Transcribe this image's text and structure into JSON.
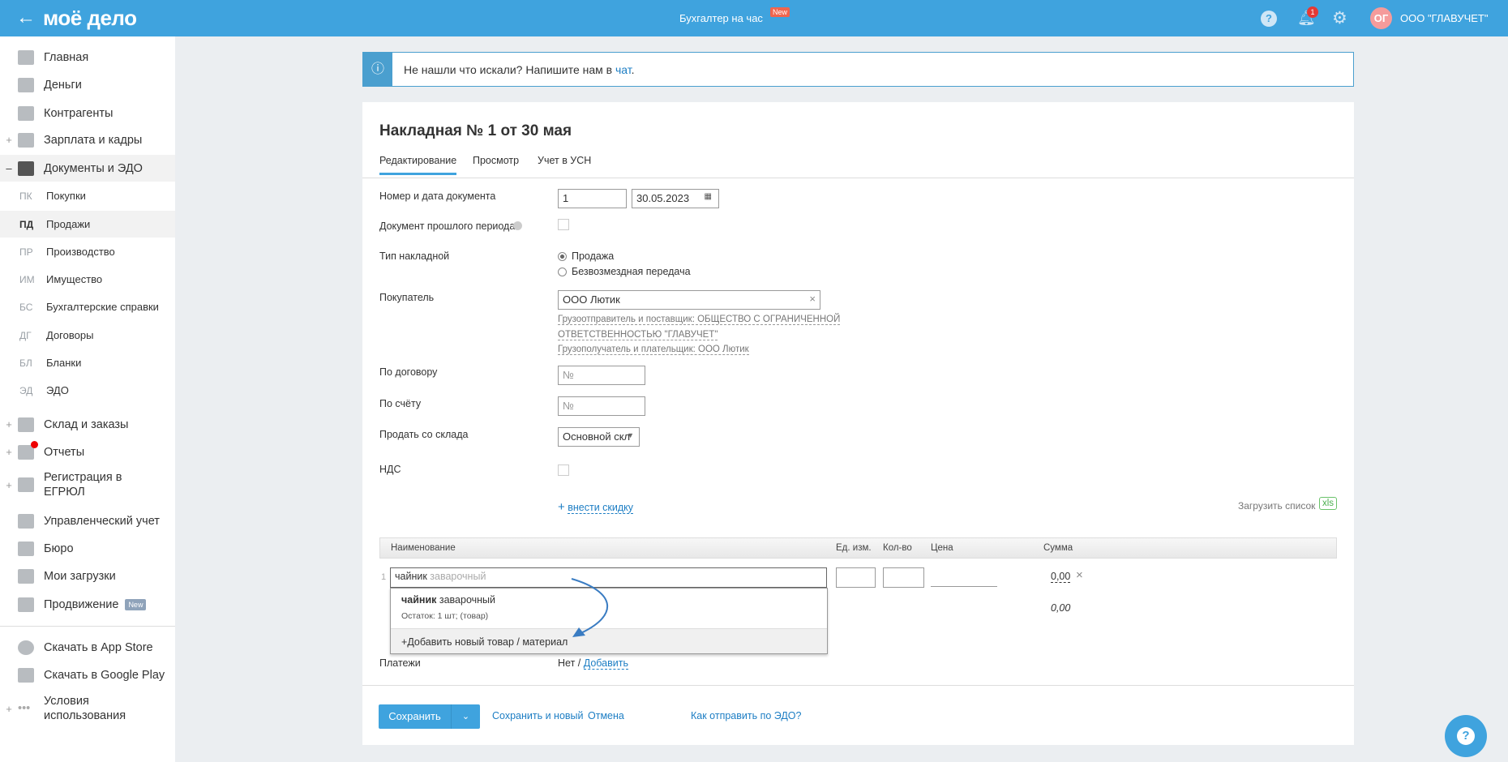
{
  "header": {
    "logo": "моё дело",
    "center_link": "Бухгалтер на час",
    "new_badge": "New",
    "notifications_count": "1",
    "avatar_initials": "ОГ",
    "company": "ООО \"ГЛАВУЧЕТ\""
  },
  "sidebar": {
    "items": [
      {
        "label": "Главная"
      },
      {
        "label": "Деньги"
      },
      {
        "label": "Контрагенты"
      },
      {
        "label": "Зарплата и кадры"
      },
      {
        "label": "Документы и ЭДО"
      }
    ],
    "sub": [
      {
        "abbr": "ПК",
        "label": "Покупки"
      },
      {
        "abbr": "ПД",
        "label": "Продажи"
      },
      {
        "abbr": "ПР",
        "label": "Производство"
      },
      {
        "abbr": "ИМ",
        "label": "Имущество"
      },
      {
        "abbr": "БС",
        "label": "Бухгалтерские справки"
      },
      {
        "abbr": "ДГ",
        "label": "Договоры"
      },
      {
        "abbr": "БЛ",
        "label": "Бланки"
      },
      {
        "abbr": "ЭД",
        "label": "ЭДО"
      }
    ],
    "items2": [
      {
        "label": "Склад и заказы"
      },
      {
        "label": "Отчеты"
      },
      {
        "label": "Регистрация в ЕГРЮЛ"
      },
      {
        "label": "Управленческий учет"
      },
      {
        "label": "Бюро"
      },
      {
        "label": "Мои загрузки"
      },
      {
        "label": "Продвижение"
      }
    ],
    "promo_badge": "New",
    "bottom": [
      {
        "label": "Скачать в App Store"
      },
      {
        "label": "Скачать в Google Play"
      },
      {
        "label": "Условия использования"
      }
    ]
  },
  "info": {
    "text": "Не нашли что искали? Напишите нам в ",
    "link": "чат",
    "dot": "."
  },
  "doc": {
    "title": "Накладная № 1 от 30 мая",
    "tabs": [
      "Редактирование",
      "Просмотр",
      "Учет в УСН"
    ],
    "labels": {
      "number_date": "Номер и дата документа",
      "past_period": "Документ прошлого периода",
      "type": "Тип накладной",
      "buyer": "Покупатель",
      "contract": "По договору",
      "invoice": "По счёту",
      "warehouse": "Продать со склада",
      "vat": "НДС",
      "payments": "Платежи"
    },
    "number": "1",
    "date": "30.05.2023",
    "type_options": [
      "Продажа",
      "Безвозмездная передача"
    ],
    "buyer": "ООО Лютик",
    "shipper": "Грузоотправитель и поставщик: ОБЩЕСТВО С ОГРАНИЧЕННОЙ",
    "shipper2": "ОТВЕТСТВЕННОСТЬЮ \"ГЛАВУЧЕТ\"",
    "consignee": "Грузополучатель и плательщик: ООО Лютик",
    "contract_ph": "№",
    "invoice_ph": "№",
    "warehouse": "Основной скл",
    "discount": "внести скидку",
    "upload_list": "Загрузить список",
    "xls": "xls",
    "columns": [
      "Наименование",
      "Ед. изм.",
      "Кол-во",
      "Цена",
      "Сумма"
    ],
    "row": {
      "num": "1",
      "name_typed": "чайник",
      "name_hint": " заварочный",
      "sum": "0,00"
    },
    "total": "0,00",
    "suggest": {
      "bold": "чайник",
      "rest": " заварочный",
      "meta": "Остаток: 1 шт; (товар)",
      "add": "Добавить новый товар / материал"
    },
    "payments_none": "Нет / ",
    "payments_add": "Добавить"
  },
  "footer": {
    "save": "Сохранить",
    "save_new": "Сохранить и новый",
    "cancel": "Отмена",
    "edo": "Как отправить по ЭДО?"
  },
  "help": "?"
}
